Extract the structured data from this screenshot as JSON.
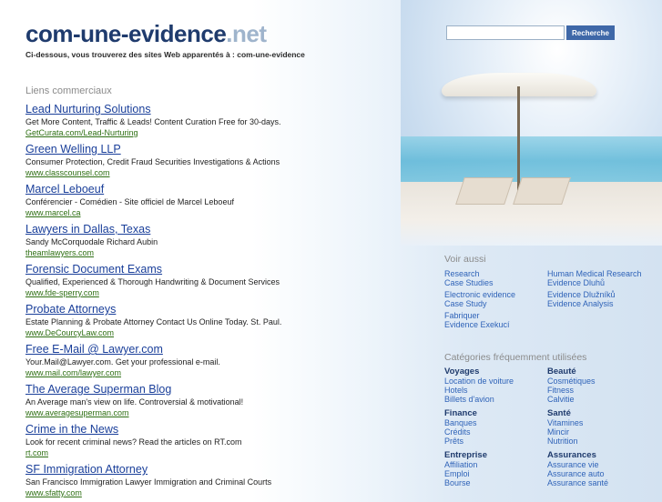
{
  "header": {
    "logo_main": "com-une-evidence",
    "logo_tld": ".net",
    "tagline": "Ci-dessous, vous trouverez des sites Web apparentés à : com-une-evidence"
  },
  "search": {
    "value": "",
    "placeholder": "",
    "button_label": "Recherche"
  },
  "sponsored": {
    "label": "Liens commerciaux",
    "listings": [
      {
        "title": "Lead Nurturing Solutions",
        "desc": "Get More Content, Traffic & Leads! Content Curation Free for 30-days.",
        "url": "GetCurata.com/Lead-Nurturing"
      },
      {
        "title": "Green Welling LLP",
        "desc": "Consumer Protection, Credit Fraud Securities Investigations & Actions",
        "url": "www.classcounsel.com"
      },
      {
        "title": "Marcel Leboeuf",
        "desc": "Conférencier - Comédien - Site officiel de Marcel Leboeuf",
        "url": "www.marcel.ca"
      },
      {
        "title": "Lawyers in Dallas, Texas",
        "desc": "Sandy McCorquodale Richard Aubin",
        "url": "theamlawyers.com"
      },
      {
        "title": "Forensic Document Exams",
        "desc": "Qualified, Experienced & Thorough Handwriting & Document Services",
        "url": "www.fde-sperry.com"
      },
      {
        "title": "Probate Attorneys",
        "desc": "Estate Planning & Probate Attorney Contact Us Online Today. St. Paul.",
        "url": "www.DeCourcyLaw.com"
      },
      {
        "title": "Free E-Mail @ Lawyer.com",
        "desc": "Your.Mail@Lawyer.com. Get your professional e-mail.",
        "url": "www.mail.com/lawyer.com"
      },
      {
        "title": "The Average Superman Blog",
        "desc": "An Average man's view on life. Controversial & motivational!",
        "url": "www.averagesuperman.com"
      },
      {
        "title": "Crime in the News",
        "desc": "Look for recent criminal news? Read the articles on RT.com",
        "url": "rt.com"
      },
      {
        "title": "SF Immigration Attorney",
        "desc": "San Francisco Immigration Lawyer Immigration and Criminal Courts",
        "url": "www.sfatty.com"
      }
    ]
  },
  "voir_aussi": {
    "label": "Voir aussi",
    "items": [
      [
        "Research",
        "Case Studies"
      ],
      [
        "Human Medical Research",
        "Evidence Dluhů"
      ],
      [
        "Electronic evidence",
        "Case Study"
      ],
      [
        "Evidence Dlužníků",
        "Evidence Analysis"
      ],
      [
        "Fabriquer",
        "Evidence Exekucí"
      ]
    ]
  },
  "categories": {
    "label": "Catégories fréquemment utilisées",
    "groups": [
      {
        "head": "Voyages",
        "links": [
          "Location de voiture",
          "Hotels",
          "Billets d'avion"
        ]
      },
      {
        "head": "Beauté",
        "links": [
          "Cosmétiques",
          "Fitness",
          "Calvitie"
        ]
      },
      {
        "head": "Finance",
        "links": [
          "Banques",
          "Crédits",
          "Prêts"
        ]
      },
      {
        "head": "Santé",
        "links": [
          "Vitamines",
          "Mincir",
          "Nutrition"
        ]
      },
      {
        "head": "Entreprise",
        "links": [
          "Affiliation",
          "Emploi",
          "Bourse"
        ]
      },
      {
        "head": "Assurances",
        "links": [
          "Assurance vie",
          "Assurance auto",
          "Assurance santé"
        ]
      }
    ]
  }
}
